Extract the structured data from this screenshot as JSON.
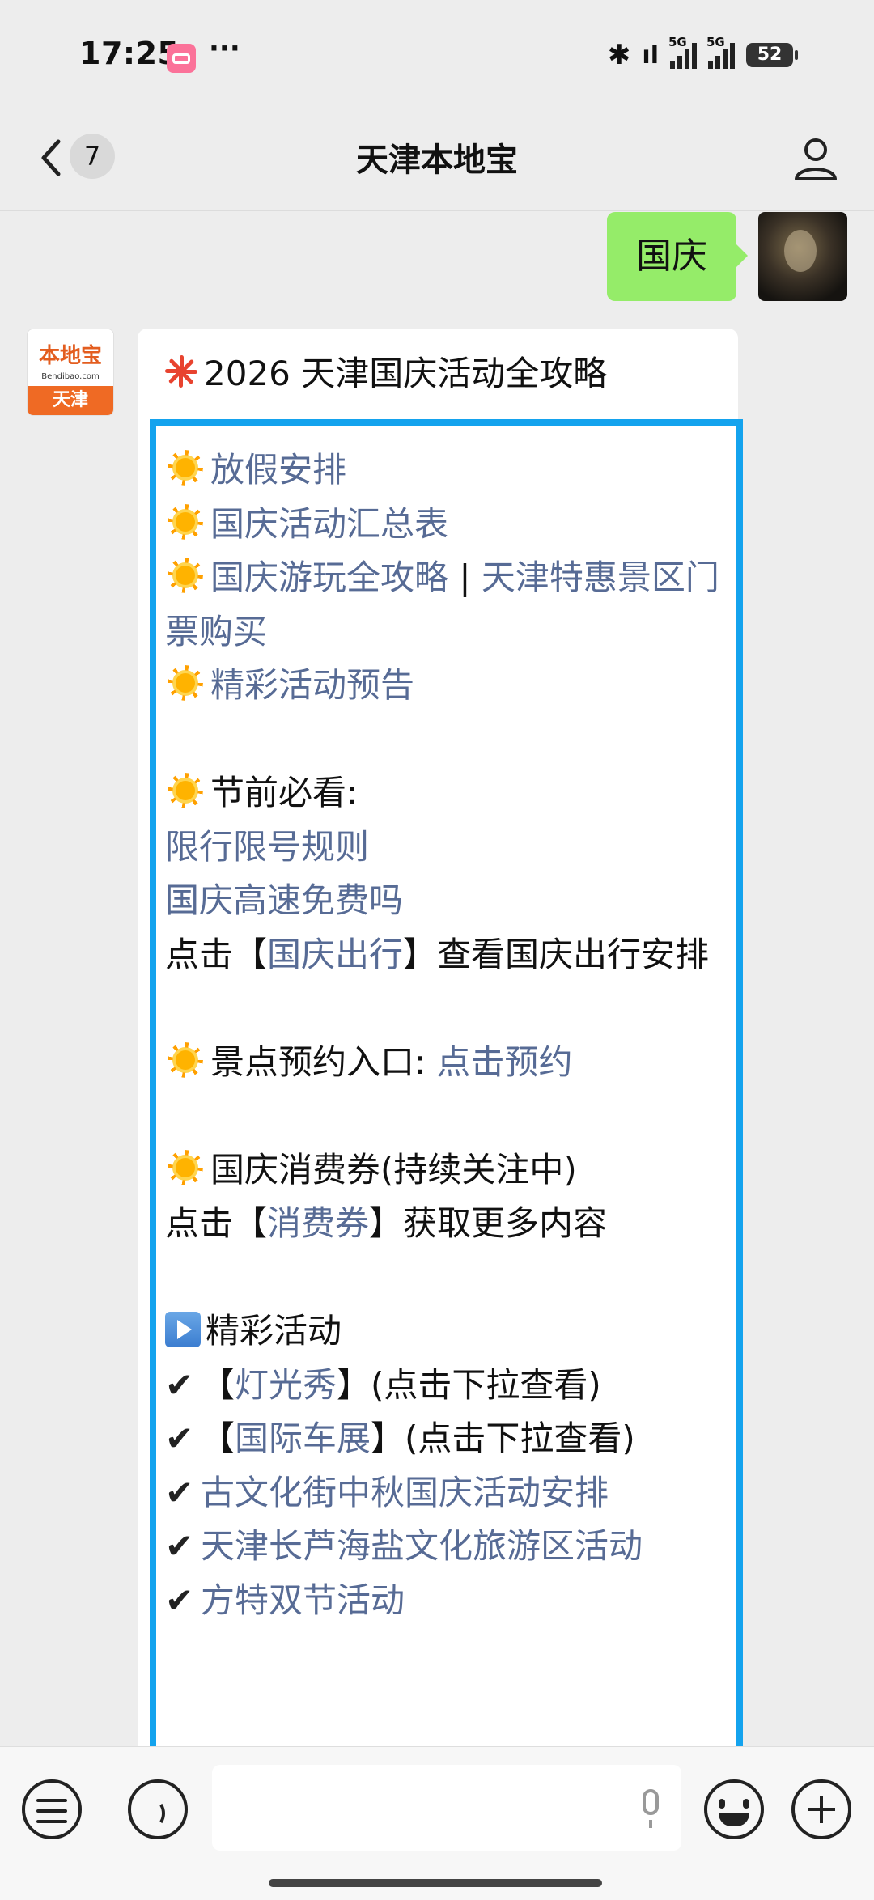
{
  "status_bar": {
    "time": "17:25",
    "more": "···",
    "network": "5G",
    "battery": "52"
  },
  "nav": {
    "unread_count": "7",
    "title": "天津本地宝"
  },
  "outgoing": {
    "text": "国庆"
  },
  "bot_avatar": {
    "title": "本地宝",
    "url": "Bendibao.com",
    "city": "天津"
  },
  "article": {
    "title": "2026 天津国庆活动全攻略",
    "items": {
      "i1": "放假安排",
      "i2": "国庆活动汇总表",
      "i3a": "国庆游玩全攻略",
      "i3sep": "|",
      "i3b": "天津特惠景区门票购买",
      "i4": "精彩活动预告",
      "must_see": "节前必看:",
      "limit_rule": "限行限号规则",
      "highway": "国庆高速免费吗",
      "click_prefix": "点击【",
      "travel_link": "国庆出行",
      "travel_suffix": "】查看国庆出行安排",
      "scenic_label": "景点预约入口:",
      "scenic_link": "点击预约",
      "voucher_title": "国庆消费券(持续关注中)",
      "voucher_prefix": "点击【",
      "voucher_link": "消费券",
      "voucher_suffix": "】获取更多内容",
      "events_title": "精彩活动",
      "check": "✔",
      "bracket_open": "【",
      "light_show": "灯光秀",
      "light_suffix": "】(点击下拉查看)",
      "car_show": "国际车展",
      "car_suffix": "】(点击下拉查看)",
      "ancient_street": "古文化街中秋国庆活动安排",
      "salt_area": "天津长芦海盐文化旅游区活动",
      "fantawild": "方特双节活动"
    }
  },
  "colors": {
    "link": "#576b95",
    "highlight_border": "#14a3ee",
    "outgoing_bubble": "#95ec69"
  }
}
